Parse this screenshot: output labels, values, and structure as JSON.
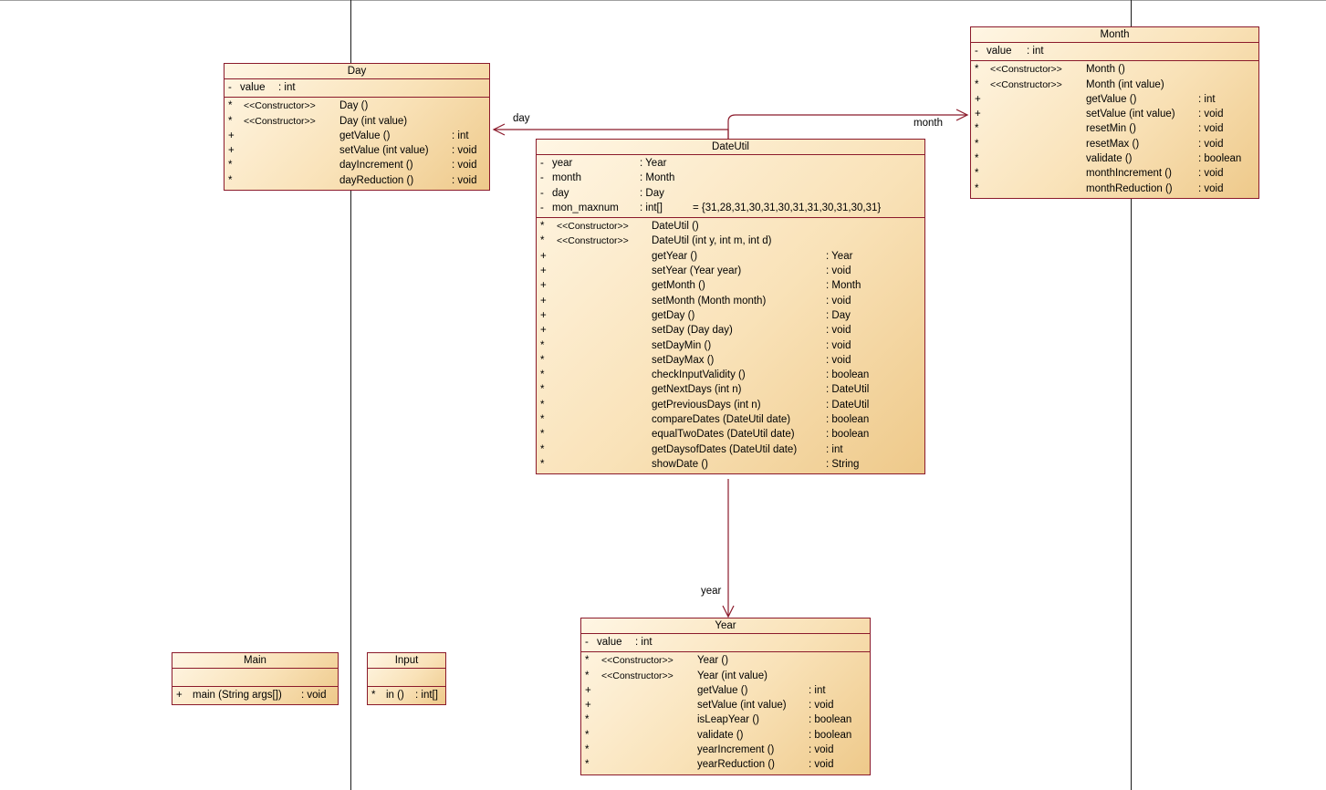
{
  "classes": {
    "day": {
      "name": "Day",
      "attributes": [
        {
          "vis": "-",
          "name": "value",
          "type": ": int"
        }
      ],
      "operations": [
        {
          "vis": "*",
          "stereo": "<<Constructor>>",
          "name": "Day ()",
          "ret": ""
        },
        {
          "vis": "*",
          "stereo": "<<Constructor>>",
          "name": "Day (int value)",
          "ret": ""
        },
        {
          "vis": "+",
          "stereo": "",
          "name": "getValue ()",
          "ret": ": int"
        },
        {
          "vis": "+",
          "stereo": "",
          "name": "setValue (int value)",
          "ret": ": void"
        },
        {
          "vis": "*",
          "stereo": "",
          "name": "dayIncrement ()",
          "ret": ": void"
        },
        {
          "vis": "*",
          "stereo": "",
          "name": "dayReduction ()",
          "ret": ": void"
        }
      ]
    },
    "month": {
      "name": "Month",
      "attributes": [
        {
          "vis": "-",
          "name": "value",
          "type": ": int"
        }
      ],
      "operations": [
        {
          "vis": "*",
          "stereo": "<<Constructor>>",
          "name": "Month ()",
          "ret": ""
        },
        {
          "vis": "*",
          "stereo": "<<Constructor>>",
          "name": "Month (int value)",
          "ret": ""
        },
        {
          "vis": "+",
          "stereo": "",
          "name": "getValue ()",
          "ret": ": int"
        },
        {
          "vis": "+",
          "stereo": "",
          "name": "setValue (int value)",
          "ret": ": void"
        },
        {
          "vis": "*",
          "stereo": "",
          "name": "resetMin ()",
          "ret": ": void"
        },
        {
          "vis": "*",
          "stereo": "",
          "name": "resetMax ()",
          "ret": ": void"
        },
        {
          "vis": "*",
          "stereo": "",
          "name": "validate ()",
          "ret": ": boolean"
        },
        {
          "vis": "*",
          "stereo": "",
          "name": "monthIncrement ()",
          "ret": ": void"
        },
        {
          "vis": "*",
          "stereo": "",
          "name": "monthReduction ()",
          "ret": ": void"
        }
      ]
    },
    "dateutil": {
      "name": "DateUtil",
      "attributes": [
        {
          "vis": "-",
          "name": "year",
          "type": ": Year"
        },
        {
          "vis": "-",
          "name": "month",
          "type": ": Month"
        },
        {
          "vis": "-",
          "name": "day",
          "type": ": Day"
        },
        {
          "vis": "-",
          "name": "mon_maxnum",
          "type": ": int[]",
          "init": "= {31,28,31,30,31,30,31,31,30,31,30,31}"
        }
      ],
      "operations": [
        {
          "vis": "*",
          "stereo": "<<Constructor>>",
          "name": "DateUtil ()",
          "ret": ""
        },
        {
          "vis": "*",
          "stereo": "<<Constructor>>",
          "name": "DateUtil (int y, int m, int d)",
          "ret": ""
        },
        {
          "vis": "+",
          "stereo": "",
          "name": "getYear ()",
          "ret": ": Year"
        },
        {
          "vis": "+",
          "stereo": "",
          "name": "setYear (Year year)",
          "ret": ": void"
        },
        {
          "vis": "+",
          "stereo": "",
          "name": "getMonth ()",
          "ret": ": Month"
        },
        {
          "vis": "+",
          "stereo": "",
          "name": "setMonth (Month month)",
          "ret": ": void"
        },
        {
          "vis": "+",
          "stereo": "",
          "name": "getDay ()",
          "ret": ": Day"
        },
        {
          "vis": "+",
          "stereo": "",
          "name": "setDay (Day day)",
          "ret": ": void"
        },
        {
          "vis": "*",
          "stereo": "",
          "name": "setDayMin ()",
          "ret": ": void"
        },
        {
          "vis": "*",
          "stereo": "",
          "name": "setDayMax ()",
          "ret": ": void"
        },
        {
          "vis": "*",
          "stereo": "",
          "name": "checkInputValidity ()",
          "ret": ": boolean"
        },
        {
          "vis": "*",
          "stereo": "",
          "name": "getNextDays (int n)",
          "ret": ": DateUtil"
        },
        {
          "vis": "*",
          "stereo": "",
          "name": "getPreviousDays (int n)",
          "ret": ": DateUtil"
        },
        {
          "vis": "*",
          "stereo": "",
          "name": "compareDates (DateUtil date)",
          "ret": ": boolean"
        },
        {
          "vis": "*",
          "stereo": "",
          "name": "equalTwoDates (DateUtil date)",
          "ret": ": boolean"
        },
        {
          "vis": "*",
          "stereo": "",
          "name": "getDaysofDates (DateUtil date)",
          "ret": ": int"
        },
        {
          "vis": "*",
          "stereo": "",
          "name": "showDate ()",
          "ret": ": String"
        }
      ]
    },
    "year": {
      "name": "Year",
      "attributes": [
        {
          "vis": "-",
          "name": "value",
          "type": ": int"
        }
      ],
      "operations": [
        {
          "vis": "*",
          "stereo": "<<Constructor>>",
          "name": "Year ()",
          "ret": ""
        },
        {
          "vis": "*",
          "stereo": "<<Constructor>>",
          "name": "Year (int value)",
          "ret": ""
        },
        {
          "vis": "+",
          "stereo": "",
          "name": "getValue ()",
          "ret": ": int"
        },
        {
          "vis": "+",
          "stereo": "",
          "name": "setValue (int value)",
          "ret": ": void"
        },
        {
          "vis": "*",
          "stereo": "",
          "name": "isLeapYear ()",
          "ret": ": boolean"
        },
        {
          "vis": "*",
          "stereo": "",
          "name": "validate ()",
          "ret": ": boolean"
        },
        {
          "vis": "*",
          "stereo": "",
          "name": "yearIncrement ()",
          "ret": ": void"
        },
        {
          "vis": "*",
          "stereo": "",
          "name": "yearReduction ()",
          "ret": ": void"
        }
      ]
    },
    "main": {
      "name": "Main",
      "attributes": [],
      "operations": [
        {
          "vis": "+",
          "name": "main (String args[])",
          "ret": ": void"
        }
      ]
    },
    "input": {
      "name": "Input",
      "attributes": [],
      "operations": [
        {
          "vis": "*",
          "name": "in ()",
          "ret": ": int[]"
        }
      ]
    }
  },
  "associations": {
    "day_label": "day",
    "month_label": "month",
    "year_label": "year"
  },
  "colors": {
    "border": "#8b1a2b",
    "link": "#8b1a2b",
    "fill_light": "#fff6e4",
    "fill_dark": "#eec98a"
  }
}
